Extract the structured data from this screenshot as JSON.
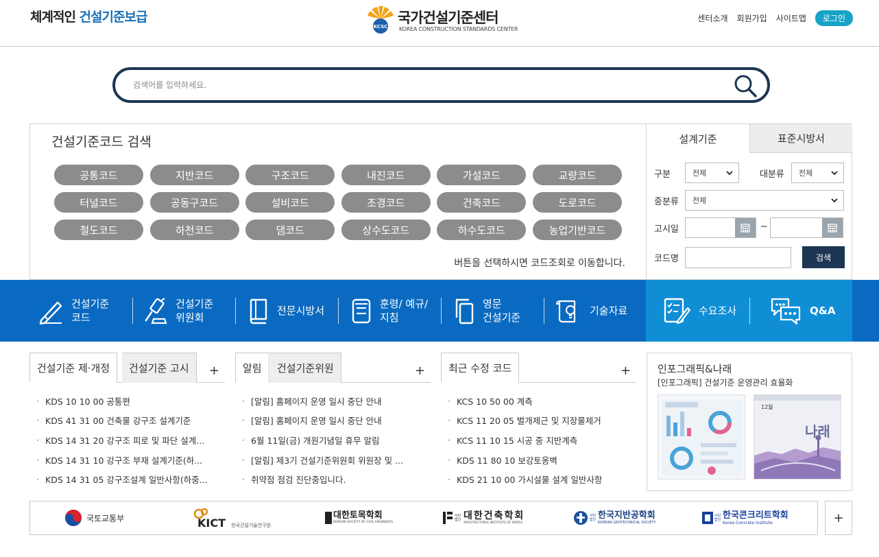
{
  "header": {
    "slogan_a": "체계적인",
    "slogan_b": "건설기준보급",
    "logo_title": "국가건설기준센터",
    "logo_sub": "KOREA CONSTRUCTION STANDARDS CENTER",
    "logo_mark_text": "KCSC",
    "util": [
      "센터소개",
      "회원가입",
      "사이트맵"
    ],
    "login": "로그인"
  },
  "search": {
    "placeholder": "검색어를 입력하세요."
  },
  "code_search": {
    "title": "건설기준코드 검색",
    "buttons": [
      "공통코드",
      "지반코드",
      "구조코드",
      "내진코드",
      "가설코드",
      "교량코드",
      "터널코드",
      "공동구코드",
      "설비코드",
      "조경코드",
      "건축코드",
      "도로코드",
      "철도코드",
      "하천코드",
      "댐코드",
      "상수도코드",
      "하수도코드",
      "농업기반코드"
    ],
    "hint": "버튼을 선택하시면 코드조회로 이동합니다."
  },
  "filter": {
    "tabs": [
      "설계기준",
      "표준시방서"
    ],
    "label_gubun": "구분",
    "label_daebun": "대분류",
    "label_jungbun": "중분류",
    "label_gosi": "고시일",
    "label_codename": "코드명",
    "gubun_value": "전체",
    "daebun_value": "전체",
    "jungbun_value": "전체",
    "tilde": "~",
    "search_btn": "검색"
  },
  "menu": {
    "items": [
      {
        "l1": "건설기준",
        "l2": "코드"
      },
      {
        "l1": "건설기준",
        "l2": "위원회"
      },
      {
        "l1": "전문시방서",
        "l2": ""
      },
      {
        "l1": "훈령/ 예규/",
        "l2": "지침"
      },
      {
        "l1": "영문",
        "l2": "건설기준"
      },
      {
        "l1": "기술자료",
        "l2": ""
      }
    ],
    "right": [
      "수요조사",
      "Q&A"
    ]
  },
  "boards": [
    {
      "tabs": [
        "건설기준 제·개정",
        "건설기준 고시"
      ],
      "items": [
        "KDS 10 10 00 공통편",
        "KDS 41 31 00 건축물 강구조 설계기준",
        "KDS 14 31 20 강구조 피로 및 파단 설계...",
        "KDS 14 31 10 강구조 부재 설계기준(하...",
        "KDS 14 31 05 강구조설계 일반사항(하중..."
      ]
    },
    {
      "tabs": [
        "알림",
        "건설기준위원"
      ],
      "items": [
        "[알림] 홈페이지 운영 일시 중단 안내",
        "[알림] 홈페이지 운영 일시 중단 안내",
        "6월 11일(금) 개원기념일 휴무 알림",
        "[알림] 제3기 건설기준위원회 위원장 및 ...",
        "취약점 점검 진단중입니다."
      ]
    },
    {
      "tabs": [
        "최근 수정 코드"
      ],
      "items": [
        "KCS 10 50 00 계측",
        "KCS 11 20 05 벌개제근 및 지장물제거",
        "KCS 11 10 15 시공 중 지반계측",
        "KDS 11 80 10 보강토옹벽",
        "KDS 21 10 00 가시설물 설계 일반사항"
      ]
    }
  ],
  "plus": "+",
  "bullet": "·",
  "info": {
    "title": "인포그래픽&나래",
    "sub": "[인포그래픽] 건설기준 운영관리 효율화",
    "magazine_text": "나래",
    "magazine_issue": "12월"
  },
  "partners": {
    "molit": "국토교통부",
    "kict": "KICT",
    "kict_sub": "한국건설기술연구원",
    "ksce": "대한토목학회",
    "ksce_sub": "KOREAN SOCIETY OF CIVIL ENGINEERS",
    "aik_prefix": "사단법인",
    "aik": "대한건축학회",
    "aik_sub": "ARCHITECTURAL INSTITUTE OF KOREA",
    "kgs_prefix": "사단법인",
    "kgs": "한국지반공학회",
    "kgs_sub": "KOREAN GEOTECHNICAL SOCIETY",
    "kci_prefix": "사단법인",
    "kci": "한국콘크리트학회",
    "kci_sub": "Korea Concrete Institute"
  },
  "colors": {
    "navy": "#1c3653",
    "band": "#0a6ac1",
    "band_right": "#0f8ed6",
    "login": "#17a3c6",
    "code_btn": "#8c8c8c"
  }
}
